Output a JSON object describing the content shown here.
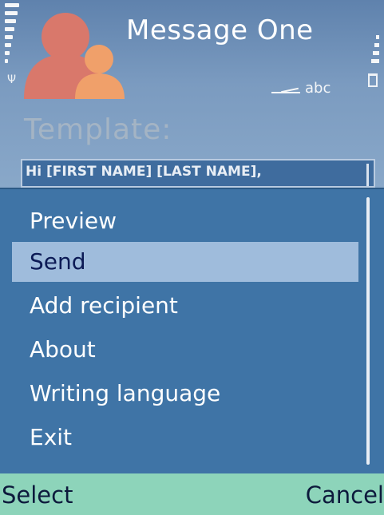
{
  "window": {
    "title": "Message One",
    "input_mode": "abc",
    "icons": [
      "signal-strength-icon",
      "antenna-icon",
      "app-contacts-icon",
      "pen-input-icon",
      "battery-icon"
    ]
  },
  "form": {
    "template_label": "Template:",
    "template_value": "Hi [FIRST NAME] [LAST NAME],"
  },
  "menu": {
    "items": [
      {
        "label": "Preview"
      },
      {
        "label": "Send"
      },
      {
        "label": "Add recipient"
      },
      {
        "label": "About"
      },
      {
        "label": "Writing language"
      },
      {
        "label": "Exit"
      }
    ],
    "selected": "Send"
  },
  "softkeys": {
    "left": "Select",
    "right": "Cancel"
  },
  "colors": {
    "menu_bg": "#3f74a6",
    "highlight": "#9fbcdc",
    "softkey_bg": "#8dd4ba",
    "icon_red": "#d9786b",
    "icon_orange": "#f0a06a"
  }
}
